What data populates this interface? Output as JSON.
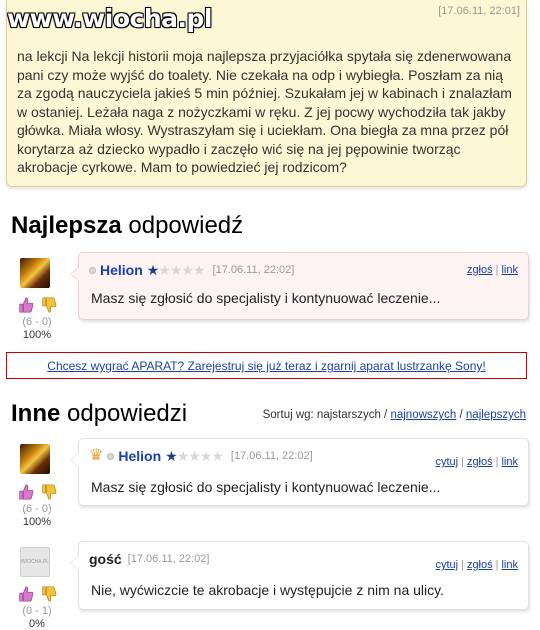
{
  "question": {
    "watermark": "www.wiocha.pl",
    "date": "[17.06.11, 22:01]",
    "text": "na lekcji Na lekcji historii moja najlepsza przyjaciółka spytała się zdenerwowana pani czy może wyjść do toalety. Nie czekała na odp i wybiegła. Poszłam za nią za zgodą nauczyciela jakieś 5 min później. Szukałam jej w kabinach i znalazłam w ostaniej. Leżała naga z nożyczkami w ręku. Z jej pocwy wychodziła tak jakby główka. Miała włosy. Wystraszyłam się i uciekłam. Ona biegła za mna przez pół korytarza aż dziecko wypadło i zaczęło wić się na jej pępowinie tworząc akrobacje cyrkowe. Mam to powiedzieć jej rodzicom?"
  },
  "best": {
    "title_bold": "Najlepsza",
    "title_rest": " odpowiedź",
    "vote_count": "(6 - 0)",
    "vote_pct": "100%",
    "user": "Helion",
    "stars": "★",
    "stars_empty": "★★★★",
    "date": "[17.06.11, 22:02]",
    "link_report": "zgłoś",
    "link_link": "link",
    "sep": "|",
    "text": "Masz się zgłosić do specjalisty i kontynuować leczenie..."
  },
  "ad": {
    "text": "Chcesz wygrać APARAT? Zarejestruj się już teraz i zgarnij aparat lustrzankę Sony!"
  },
  "others": {
    "title_bold": "Inne",
    "title_rest": " odpowiedzi",
    "sort_label": "Sortuj wg: najstarszych /",
    "sort_newest": "najnowszych",
    "sort_sep": "/",
    "sort_best": "najlepszych",
    "answers": [
      {
        "user": "Helion",
        "stars": "★",
        "stars_empty": "★★★★",
        "date": "[17.06.11, 22:02]",
        "vote_count": "(6 - 0)",
        "vote_pct": "100%",
        "link_quote": "cytuj",
        "link_report": "zgłoś",
        "link_link": "link",
        "text": "Masz się zgłosić do specjalisty i kontynuować leczenie..."
      },
      {
        "user": "gość",
        "date": "[17.06.11, 22:02]",
        "vote_count": "(0 - 1)",
        "vote_pct": "0%",
        "avatar_text": "WIOCHA.PL",
        "link_quote": "cytuj",
        "link_report": "zgłoś",
        "link_link": "link",
        "text": "Nie, wyćwiczcie te akrobacje i występujcie z nim na ulicy."
      }
    ]
  },
  "colors": {
    "link": "#1a3fb0",
    "question_bg": "#fcf7d4",
    "best_bg": "#fdf3f3",
    "ad_border": "#cc0000",
    "star": "#1f3d8a"
  },
  "icons": {
    "thumb_up": "thumb-up-icon",
    "thumb_down": "thumb-down-icon",
    "crown": "crown-icon",
    "status": "status-dot-icon"
  }
}
